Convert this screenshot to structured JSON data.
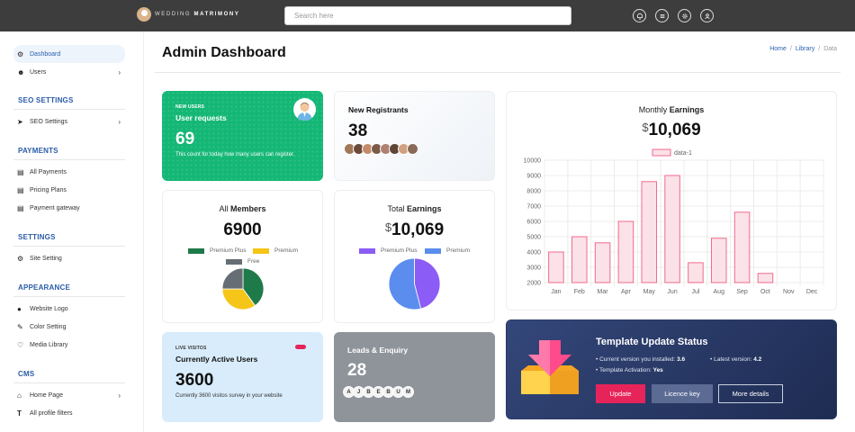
{
  "header": {
    "logo": {
      "text_light": "WEDDING",
      "text_bold": "MATRIMONY"
    },
    "search": {
      "placeholder": "Search here"
    },
    "icons": [
      "bell-icon",
      "menu-icon",
      "gear-icon",
      "user-icon"
    ]
  },
  "sidebar": {
    "dashboard": "Dashboard",
    "users": "Users",
    "seo_heading": "SEO SETTINGS",
    "seo_settings": "SEO Settings",
    "payments_heading": "PAYMENTS",
    "all_payments": "All Payments",
    "pricing_plans": "Pricing Plans",
    "payment_gateway": "Payment gateway",
    "settings_heading": "SETTINGS",
    "site_setting": "Site Setting",
    "appearance_heading": "APPEARANCE",
    "website_logo": "Website Logo",
    "color_setting": "Color Setting",
    "media_library": "Media Library",
    "cms_heading": "CMS",
    "home_page": "Home Page",
    "all_profile_filters": "All profile filters"
  },
  "page": {
    "title": "Admin Dashboard",
    "breadcrumb": {
      "home": "Home",
      "library": "Library",
      "current": "Data",
      "sep": "/"
    }
  },
  "cards": {
    "new_users": {
      "eyebrow": "NEW USERS",
      "title": "User requests",
      "value": "69",
      "note": "This count for today how many users can register."
    },
    "new_registrants": {
      "title": "New Registrants",
      "value": "38"
    },
    "all_members": {
      "title_light": "All ",
      "title_bold": "Members",
      "value": "6900",
      "legend": [
        "Premium Plus",
        "Premium",
        "Free"
      ],
      "pie": [
        {
          "label": "Premium Plus",
          "value": 40,
          "color": "#1f7a4a"
        },
        {
          "label": "Premium",
          "value": 35,
          "color": "#f5c518"
        },
        {
          "label": "Free",
          "value": 25,
          "color": "#666d75"
        }
      ]
    },
    "total_earnings": {
      "title_light": "Total ",
      "title_bold": "Earnings",
      "currency": "$",
      "value": "10,069",
      "legend": [
        "Premium Plus",
        "Premium"
      ],
      "pie": [
        {
          "label": "Premium Plus",
          "value": 46,
          "color": "#8b5cf6"
        },
        {
          "label": "Premium",
          "value": 54,
          "color": "#5b8def"
        }
      ]
    },
    "active_users": {
      "eyebrow": "LIVE VISITOS",
      "title": "Currently Active Users",
      "value": "3600",
      "note": "Currently 3600 visitos survey in your website"
    },
    "leads": {
      "title": "Leads & Enquiry",
      "value": "28",
      "letters": [
        "A",
        "J",
        "B",
        "E",
        "B",
        "U",
        "M"
      ]
    },
    "template": {
      "title": "Template Update Status",
      "current_label": "Current version you installed:",
      "current_value": "3.6",
      "latest_label": "Latest version:",
      "latest_value": "4.2",
      "activation_label": "Template Activation:",
      "activation_value": "Yes",
      "btn_update": "Update",
      "btn_licence": "Licence key",
      "btn_more": "More details"
    }
  },
  "monthly": {
    "title_light": "Monthly ",
    "title_bold": "Earnings",
    "currency": "$",
    "value": "10,069"
  },
  "chart_data": {
    "type": "bar",
    "title": "Monthly Earnings",
    "categories": [
      "Jan",
      "Feb",
      "Mar",
      "Apr",
      "May",
      "Jun",
      "Jul",
      "Aug",
      "Sep",
      "Oct",
      "Nov",
      "Dec"
    ],
    "series": [
      {
        "name": "data-1",
        "values": [
          4000,
          5000,
          4600,
          6000,
          8600,
          9000,
          3300,
          4900,
          6600,
          2600,
          0,
          0
        ]
      }
    ],
    "ylim": [
      2000,
      10000
    ],
    "yticks": [
      2000,
      3000,
      4000,
      5000,
      6000,
      7000,
      8000,
      9000,
      10000
    ],
    "grid": true,
    "legend": "top",
    "colors": {
      "fill": "#fbe2e8",
      "stroke": "#f26a8d"
    }
  },
  "colors": {
    "green": "#14b775",
    "navy": "#26365f",
    "update": "#e6245a",
    "accent": "#2a62b0"
  }
}
